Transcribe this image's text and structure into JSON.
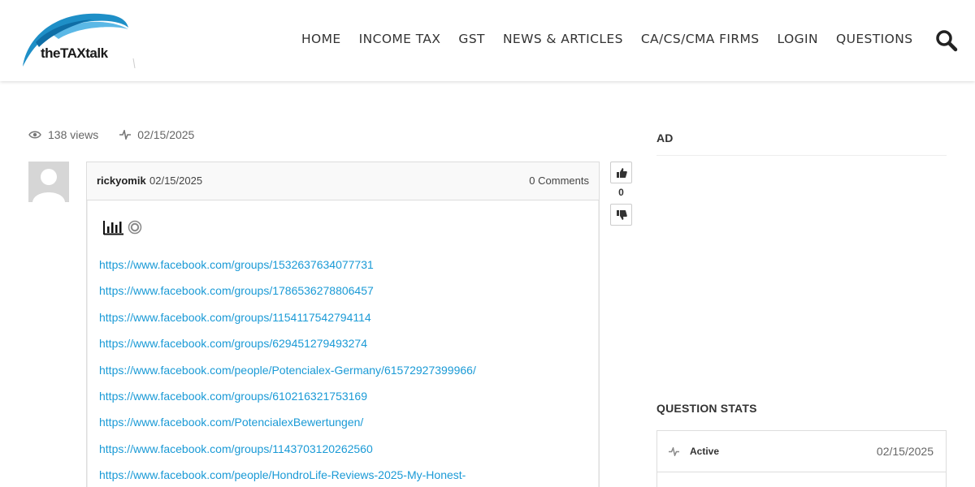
{
  "header": {
    "logo": {
      "prefix": "the",
      "highlight": "TAX",
      "suffix": "talk"
    },
    "nav": [
      {
        "label": "HOME"
      },
      {
        "label": "INCOME TAX"
      },
      {
        "label": "GST"
      },
      {
        "label": "NEWS & ARTICLES"
      },
      {
        "label": "CA/CS/CMA FIRMS"
      },
      {
        "label": "LOGIN"
      },
      {
        "label": "QUESTIONS"
      }
    ],
    "search_icon": "search-icon"
  },
  "meta": {
    "views": "138 views",
    "date": "02/15/2025"
  },
  "post": {
    "author": "rickyomik",
    "date": "02/15/2025",
    "comments": "0 Comments",
    "links": [
      "https://www.facebook.com/groups/1532637634077731",
      "https://www.facebook.com/groups/1786536278806457",
      "https://www.facebook.com/groups/1154117542794114",
      "https://www.facebook.com/groups/629451279493274",
      "https://www.facebook.com/people/Potencialex-Germany/61572927399966/",
      "https://www.facebook.com/groups/610216321753169",
      "https://www.facebook.com/PotencialexBewertungen/",
      "https://www.facebook.com/groups/1143703120262560",
      "https://www.facebook.com/people/HondroLife-Reviews-2025-My-Honest-"
    ]
  },
  "vote": {
    "count": "0"
  },
  "sidebar": {
    "ad_title": "AD",
    "stats_title": "QUESTION STATS",
    "stats": {
      "label": "Active",
      "date": "02/15/2025"
    }
  },
  "colors": {
    "link": "#1a9ad6",
    "logo_swoosh": "#1e8fc7"
  }
}
